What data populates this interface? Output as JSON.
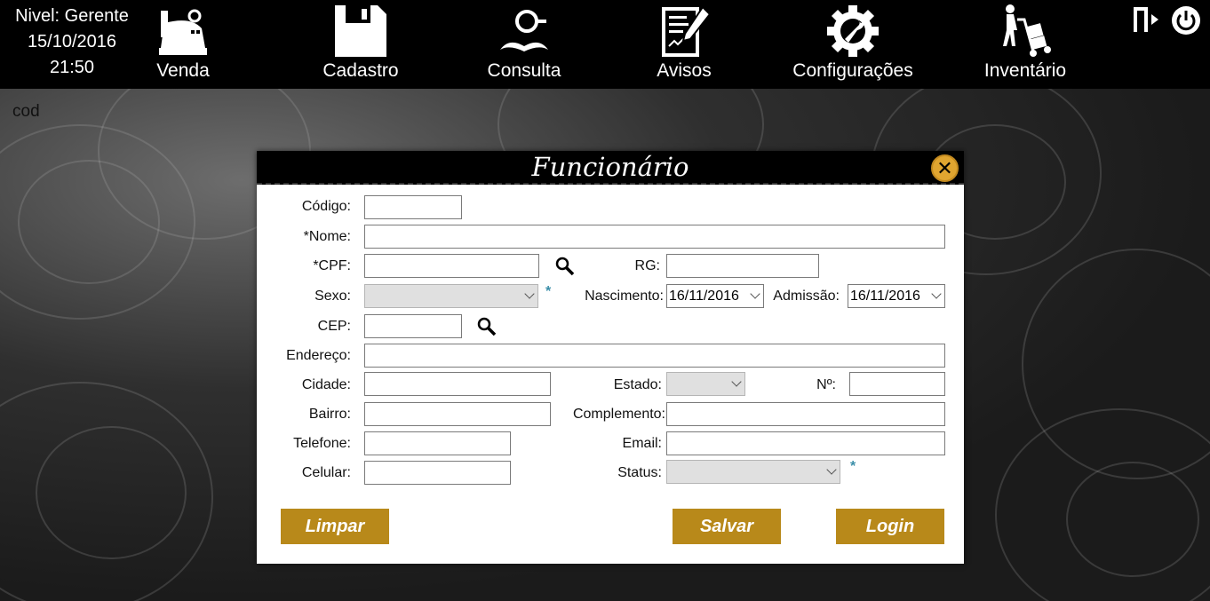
{
  "topbar": {
    "level": "Nivel: Gerente",
    "date": "15/10/2016",
    "time": "21:50",
    "nav": [
      {
        "label": "Venda",
        "icon": "cash-register-icon"
      },
      {
        "label": "Cadastro",
        "icon": "floppy-disk-icon"
      },
      {
        "label": "Consulta",
        "icon": "detective-icon"
      },
      {
        "label": "Avisos",
        "icon": "document-pen-icon"
      },
      {
        "label": "Configurações",
        "icon": "gear-wrench-icon"
      },
      {
        "label": "Inventário",
        "icon": "hand-truck-icon"
      }
    ],
    "logout_icon": "logout-door-icon",
    "power_icon": "power-icon"
  },
  "background_label": "cod",
  "modal": {
    "title": "Funcionário",
    "fields": {
      "codigo": {
        "label": "Código:",
        "value": ""
      },
      "nome": {
        "label": "*Nome:",
        "value": ""
      },
      "cpf": {
        "label": "*CPF:",
        "value": ""
      },
      "rg": {
        "label": "RG:",
        "value": ""
      },
      "sexo": {
        "label": "Sexo:",
        "value": ""
      },
      "nascimento": {
        "label": "Nascimento:",
        "value": "16/11/2016"
      },
      "admissao": {
        "label": "Admissão:",
        "value": "16/11/2016"
      },
      "cep": {
        "label": "CEP:",
        "value": ""
      },
      "endereco": {
        "label": "Endereço:",
        "value": ""
      },
      "cidade": {
        "label": "Cidade:",
        "value": ""
      },
      "estado": {
        "label": "Estado:",
        "value": ""
      },
      "numero": {
        "label": "Nº:",
        "value": ""
      },
      "bairro": {
        "label": "Bairro:",
        "value": ""
      },
      "complemento": {
        "label": "Complemento:",
        "value": ""
      },
      "telefone": {
        "label": "Telefone:",
        "value": ""
      },
      "email": {
        "label": "Email:",
        "value": ""
      },
      "celular": {
        "label": "Celular:",
        "value": ""
      },
      "status": {
        "label": "Status:",
        "value": ""
      }
    },
    "required_marker": "*",
    "buttons": {
      "limpar": "Limpar",
      "salvar": "Salvar",
      "login": "Login"
    }
  },
  "colors": {
    "accent": "#b8891a",
    "close": "#e0a530",
    "marker": "#3a8ea8"
  }
}
